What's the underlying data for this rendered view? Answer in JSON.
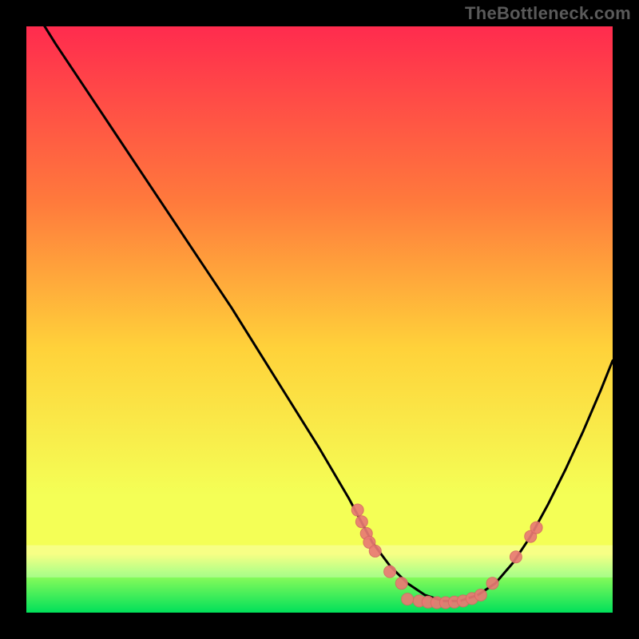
{
  "attribution": "TheBottleneck.com",
  "colors": {
    "background": "#000000",
    "gradient_top": "#ff2b4e",
    "gradient_mid_upper": "#ff7a3c",
    "gradient_mid": "#ffd23a",
    "gradient_lower": "#f4ff56",
    "gradient_bottom_band": "#9bff5a",
    "gradient_bottom": "#00e05a",
    "curve": "#000000",
    "marker_fill": "#e97a74",
    "marker_stroke": "#d66a64"
  },
  "chart_data": {
    "type": "line",
    "title": "",
    "xlabel": "",
    "ylabel": "",
    "xlim": [
      0,
      100
    ],
    "ylim": [
      0,
      100
    ],
    "curve": {
      "name": "bottleneck-curve",
      "x": [
        0,
        5,
        10,
        15,
        20,
        25,
        30,
        35,
        40,
        45,
        50,
        55,
        59,
        62,
        65,
        68,
        71,
        74,
        77,
        80,
        83,
        86,
        89,
        92,
        95,
        98,
        100
      ],
      "y": [
        105,
        97,
        89.5,
        82,
        74.5,
        67,
        59.5,
        52,
        44,
        36,
        28,
        19.5,
        12,
        8,
        5,
        3,
        2,
        2,
        3,
        5,
        8.5,
        13,
        18.5,
        24.5,
        31,
        38,
        43
      ]
    },
    "markers": {
      "name": "highlight-points",
      "points": [
        {
          "x": 56.5,
          "y": 17.5
        },
        {
          "x": 57.2,
          "y": 15.5
        },
        {
          "x": 58.0,
          "y": 13.5
        },
        {
          "x": 58.5,
          "y": 12.0
        },
        {
          "x": 59.5,
          "y": 10.5
        },
        {
          "x": 62.0,
          "y": 7.0
        },
        {
          "x": 64.0,
          "y": 5.0
        },
        {
          "x": 65.0,
          "y": 2.3
        },
        {
          "x": 67.0,
          "y": 2.0
        },
        {
          "x": 68.5,
          "y": 1.8
        },
        {
          "x": 70.0,
          "y": 1.7
        },
        {
          "x": 71.5,
          "y": 1.7
        },
        {
          "x": 73.0,
          "y": 1.8
        },
        {
          "x": 74.5,
          "y": 2.0
        },
        {
          "x": 76.0,
          "y": 2.4
        },
        {
          "x": 77.5,
          "y": 3.0
        },
        {
          "x": 79.5,
          "y": 5.0
        },
        {
          "x": 83.5,
          "y": 9.5
        },
        {
          "x": 86.0,
          "y": 13.0
        },
        {
          "x": 87.0,
          "y": 14.5
        }
      ]
    }
  }
}
